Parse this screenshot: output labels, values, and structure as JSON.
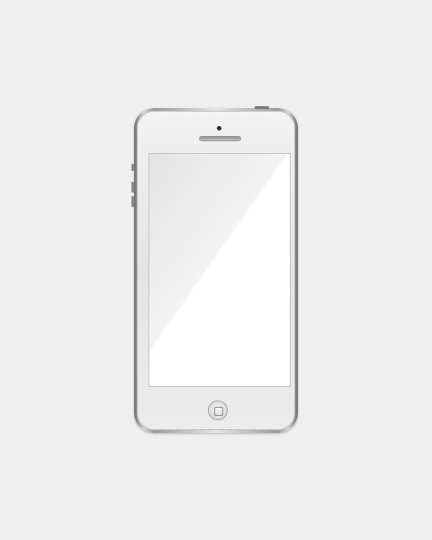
{
  "device": {
    "type": "smartphone",
    "color": "#e6e6e6",
    "screen_color": "#ffffff",
    "background_color": "#efefef"
  },
  "icons": {
    "camera": "front-camera-icon",
    "speaker": "earpiece-speaker-icon",
    "home": "home-button-icon"
  }
}
